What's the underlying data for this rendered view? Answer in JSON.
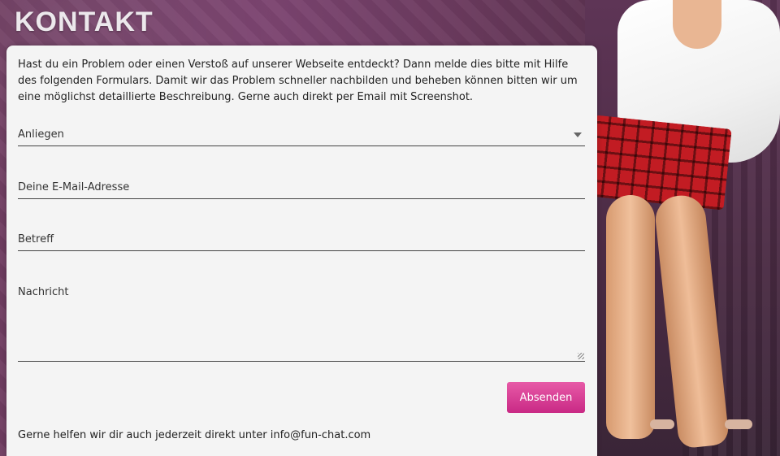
{
  "page": {
    "title": "KONTAKT"
  },
  "form": {
    "intro_text": "Hast du ein Problem oder einen Verstoß auf unserer Webseite entdeckt? Dann melde dies bitte mit Hilfe des folgenden Formulars. Damit wir das Problem schneller nachbilden und beheben können bitten wir um eine möglichst detaillierte Beschreibung. Gerne auch direkt per Email mit Screenshot.",
    "concern_label": "Anliegen",
    "email_label": "Deine E-Mail-Adresse",
    "subject_label": "Betreff",
    "message_label": "Nachricht",
    "submit_label": "Absenden"
  },
  "footer": {
    "text": "Gerne helfen wir dir auch jederzeit direkt unter info@fun-chat.com"
  },
  "colors": {
    "background": "#6f3d61",
    "card": "#f4f4f4",
    "accent": "#d63a93",
    "title": "#ece8ec"
  },
  "icons": {
    "select_caret": "chevron-down-icon",
    "textarea_resize": "resize-handle-icon"
  }
}
